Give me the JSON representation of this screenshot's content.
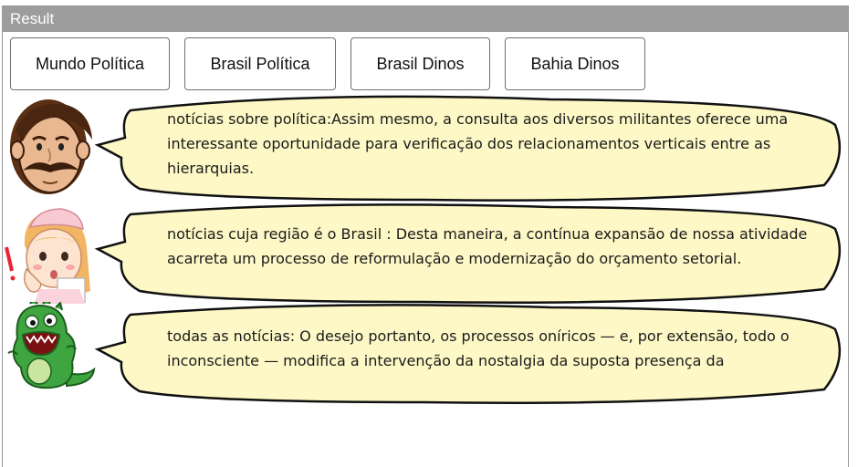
{
  "panel": {
    "title": "Result"
  },
  "buttons": [
    {
      "label": "Mundo Política"
    },
    {
      "label": "Brasil Política"
    },
    {
      "label": "Brasil Dinos"
    },
    {
      "label": "Bahia Dinos"
    }
  ],
  "messages": [
    {
      "avatar": "man-mustache",
      "text": "notícias sobre política:Assim mesmo, a consulta aos diversos militantes oferece uma interessante oportunidade para verificação dos relacionamentos verticais entre as hierarquias."
    },
    {
      "avatar": "nurse",
      "text": "notícias cuja região é o Brasil : Desta maneira, a contínua expansão de nossa atividade acarreta um processo de reformulação e modernização do orçamento setorial."
    },
    {
      "avatar": "green-dinosaur",
      "text": "todas as notícias: O desejo portanto, os processos oníricos — e, por extensão, todo o inconsciente — modifica a intervenção da nostalgia da suposta presença da"
    }
  ],
  "colors": {
    "bubble_fill": "#fdf8c6",
    "bubble_stroke": "#111111",
    "titlebar": "#9d9d9d"
  }
}
